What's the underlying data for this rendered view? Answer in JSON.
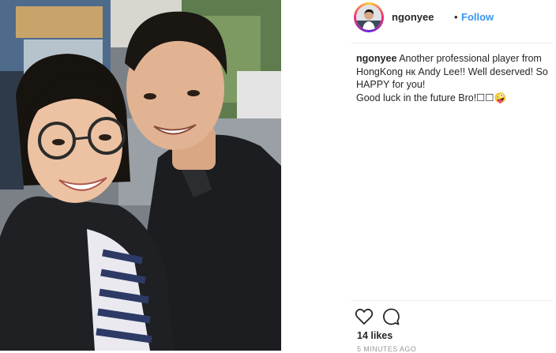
{
  "post": {
    "username": "ngonyee",
    "separator": "•",
    "follow_label": "Follow",
    "caption": {
      "author": "ngonyee",
      "line1": "Another professional player from",
      "line2": "HongKong нк Andy Lee!! Well deserved! So",
      "line3": "HAPPY for you!",
      "line4": "Good luck in the future Bro!☐☐🤪"
    },
    "likes": "14 likes",
    "timestamp": "5 MINUTES AGO"
  },
  "icons": {
    "like": "heart-outline-icon",
    "comment": "comment-bubble-icon"
  },
  "colors": {
    "follow": "#3897f0",
    "text": "#262626",
    "muted": "#999999",
    "divider": "#efefef"
  }
}
